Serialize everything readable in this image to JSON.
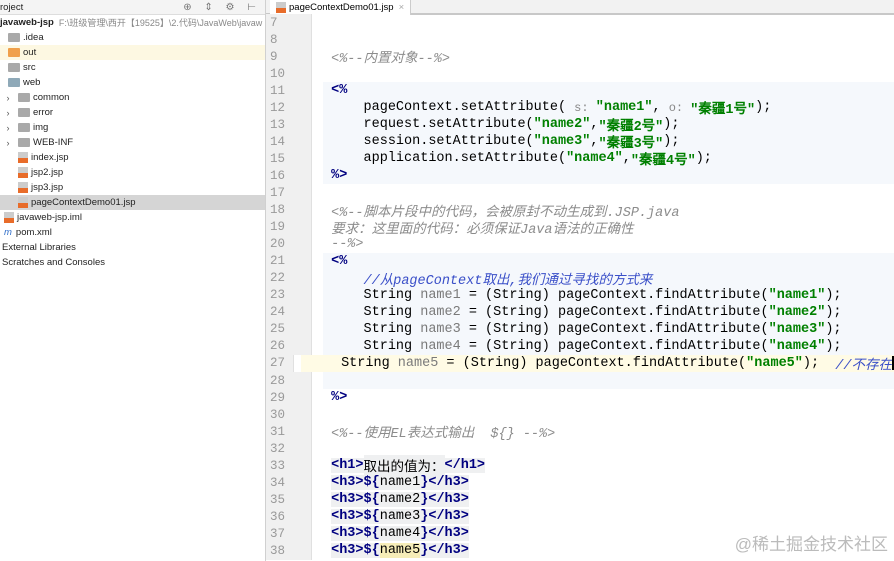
{
  "sidebar": {
    "header": "roject",
    "root": {
      "name": "javaweb-jsp",
      "path": "F:\\班级管理\\西开【19525】\\2.代码\\JavaWeb\\javaw"
    },
    "items": [
      ".idea",
      "out",
      "src",
      "web",
      "common",
      "error",
      "img",
      "WEB-INF",
      "index.jsp",
      "jsp2.jsp",
      "jsp3.jsp",
      "pageContextDemo01.jsp",
      "javaweb-jsp.iml",
      "pom.xml",
      "External Libraries",
      "Scratches and Consoles"
    ]
  },
  "tab": {
    "label": "pageContextDemo01.jsp",
    "close": "×"
  },
  "editor": {
    "lines": [
      {
        "n": "7",
        "t": []
      },
      {
        "n": "8",
        "t": []
      },
      {
        "n": "9",
        "t": [
          [
            "c",
            "<%--内置对象--%>"
          ]
        ]
      },
      {
        "n": "10",
        "t": []
      },
      {
        "n": "11",
        "j": 1,
        "t": [
          [
            "k",
            "<%"
          ]
        ]
      },
      {
        "n": "12",
        "j": 1,
        "t": [
          [
            "p",
            "    pageContext.setAttribute( "
          ],
          [
            "h",
            "s: "
          ],
          [
            "s",
            "\"name1\""
          ],
          [
            "p",
            ", "
          ],
          [
            "h",
            "o: "
          ],
          [
            "s",
            "\"秦疆1号\""
          ],
          [
            "p",
            ");"
          ]
        ]
      },
      {
        "n": "13",
        "j": 1,
        "t": [
          [
            "p",
            "    request.setAttribute("
          ],
          [
            "s",
            "\"name2\""
          ],
          [
            "p",
            ","
          ],
          [
            "s",
            "\"秦疆2号\""
          ],
          [
            "p",
            ");"
          ]
        ]
      },
      {
        "n": "14",
        "j": 1,
        "t": [
          [
            "p",
            "    session.setAttribute("
          ],
          [
            "s",
            "\"name3\""
          ],
          [
            "p",
            ","
          ],
          [
            "s",
            "\"秦疆3号\""
          ],
          [
            "p",
            ");"
          ]
        ]
      },
      {
        "n": "15",
        "j": 1,
        "t": [
          [
            "p",
            "    application.setAttribute("
          ],
          [
            "s",
            "\"name4\""
          ],
          [
            "p",
            ","
          ],
          [
            "s",
            "\"秦疆4号\""
          ],
          [
            "p",
            ");"
          ]
        ]
      },
      {
        "n": "16",
        "j": 1,
        "t": [
          [
            "k",
            "%>"
          ]
        ]
      },
      {
        "n": "17",
        "t": []
      },
      {
        "n": "18",
        "t": [
          [
            "c",
            "<%--脚本片段中的代码，会被原封不动生成到.JSP.java"
          ]
        ]
      },
      {
        "n": "19",
        "t": [
          [
            "c",
            "要求：这里面的代码：必须保证Java语法的正确性"
          ]
        ]
      },
      {
        "n": "20",
        "t": [
          [
            "c",
            "--%>"
          ]
        ]
      },
      {
        "n": "21",
        "j": 1,
        "t": [
          [
            "k",
            "<%"
          ]
        ]
      },
      {
        "n": "22",
        "j": 1,
        "t": [
          [
            "cm",
            "    //从pageContext取出,我们通过寻找的方式来"
          ]
        ]
      },
      {
        "n": "23",
        "j": 1,
        "t": [
          [
            "p",
            "    String "
          ],
          [
            "v",
            "name1"
          ],
          [
            "p",
            " = (String) pageContext.findAttribute("
          ],
          [
            "s",
            "\"name1\""
          ],
          [
            "p",
            ");"
          ]
        ]
      },
      {
        "n": "24",
        "j": 1,
        "t": [
          [
            "p",
            "    String "
          ],
          [
            "v",
            "name2"
          ],
          [
            "p",
            " = (String) pageContext.findAttribute("
          ],
          [
            "s",
            "\"name2\""
          ],
          [
            "p",
            ");"
          ]
        ]
      },
      {
        "n": "25",
        "j": 1,
        "t": [
          [
            "p",
            "    String "
          ],
          [
            "v",
            "name3"
          ],
          [
            "p",
            " = (String) pageContext.findAttribute("
          ],
          [
            "s",
            "\"name3\""
          ],
          [
            "p",
            ");"
          ]
        ]
      },
      {
        "n": "26",
        "j": 1,
        "t": [
          [
            "p",
            "    String "
          ],
          [
            "v",
            "name4"
          ],
          [
            "p",
            " = (String) pageContext.findAttribute("
          ],
          [
            "s",
            "\"name4\""
          ],
          [
            "p",
            ");"
          ]
        ]
      },
      {
        "n": "27",
        "j": 1,
        "cur": 1,
        "t": [
          [
            "p",
            "    String "
          ],
          [
            "v",
            "name5"
          ],
          [
            "p",
            " = (String) pageContext.findAttribute("
          ],
          [
            "s",
            "\"name5\""
          ],
          [
            "p",
            ");  "
          ],
          [
            "cm",
            "//不存在"
          ]
        ]
      },
      {
        "n": "28",
        "j": 1,
        "t": []
      },
      {
        "n": "29",
        "t": [
          [
            "k",
            "%>"
          ]
        ]
      },
      {
        "n": "30",
        "t": []
      },
      {
        "n": "31",
        "t": [
          [
            "c",
            "<%--使用EL表达式输出  ${} --%>"
          ]
        ]
      },
      {
        "n": "32",
        "t": []
      },
      {
        "n": "33",
        "t": [
          [
            "t",
            "<h1>"
          ],
          [
            "tx",
            "取出的值为："
          ],
          [
            "t",
            "</h1>"
          ]
        ]
      },
      {
        "n": "34",
        "t": [
          [
            "t",
            "<h3>"
          ],
          [
            "el",
            "${"
          ],
          [
            "tx",
            "name1"
          ],
          [
            "el",
            "}"
          ],
          [
            "t",
            "</h3>"
          ]
        ]
      },
      {
        "n": "35",
        "t": [
          [
            "t",
            "<h3>"
          ],
          [
            "el",
            "${"
          ],
          [
            "tx",
            "name2"
          ],
          [
            "el",
            "}"
          ],
          [
            "t",
            "</h3>"
          ]
        ]
      },
      {
        "n": "36",
        "t": [
          [
            "t",
            "<h3>"
          ],
          [
            "el",
            "${"
          ],
          [
            "tx",
            "name3"
          ],
          [
            "el",
            "}"
          ],
          [
            "t",
            "</h3>"
          ]
        ]
      },
      {
        "n": "37",
        "t": [
          [
            "t",
            "<h3>"
          ],
          [
            "el",
            "${"
          ],
          [
            "tx",
            "name4"
          ],
          [
            "el",
            "}"
          ],
          [
            "t",
            "</h3>"
          ]
        ]
      },
      {
        "n": "38",
        "t": [
          [
            "t",
            "<h3>"
          ],
          [
            "el",
            "${"
          ],
          [
            "hl5",
            "name5"
          ],
          [
            "el",
            "}"
          ],
          [
            "t",
            "</h3>"
          ]
        ]
      }
    ]
  },
  "watermark": "@稀土掘金技术社区"
}
